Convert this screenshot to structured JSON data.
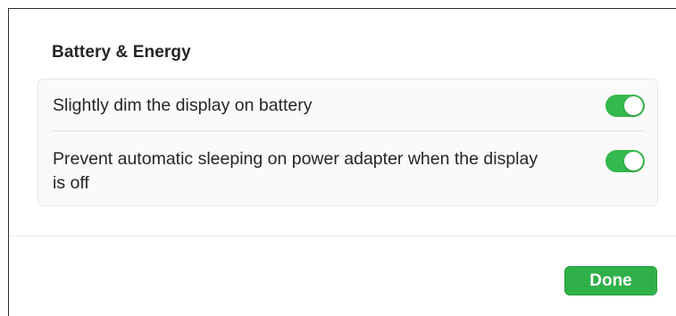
{
  "section": {
    "title": "Battery & Energy"
  },
  "settings": [
    {
      "label": "Slightly dim the display on battery",
      "enabled": true
    },
    {
      "label": "Prevent automatic sleeping on power adapter when the display is off",
      "enabled": true
    }
  ],
  "footer": {
    "done_label": "Done"
  },
  "colors": {
    "toggle_on": "#35b84d",
    "done_button": "#2fb049"
  }
}
